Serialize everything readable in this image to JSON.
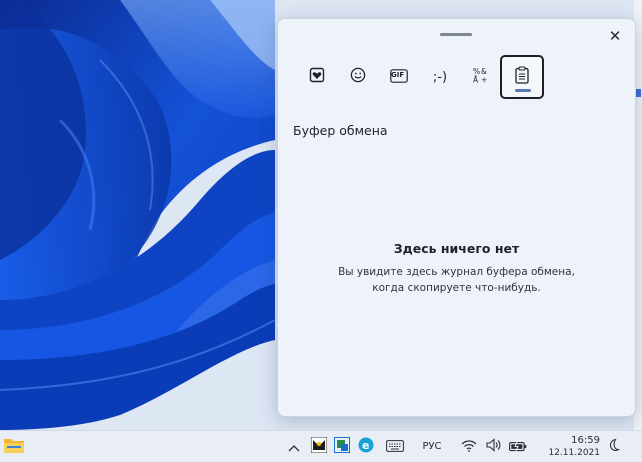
{
  "panel": {
    "close_label": "✕",
    "tabs": [
      {
        "name": "recently-used-tab",
        "icon": "heart-sticker-icon",
        "active": false
      },
      {
        "name": "emoji-tab",
        "icon": "smiley-icon",
        "active": false
      },
      {
        "name": "gif-tab",
        "icon": "gif-icon",
        "label": "GIF",
        "active": false
      },
      {
        "name": "kaomoji-tab",
        "icon": "kaomoji-icon",
        "label": ";-)",
        "active": false
      },
      {
        "name": "symbols-tab",
        "icon": "symbols-icon",
        "active": false
      },
      {
        "name": "clipboard-tab",
        "icon": "clipboard-icon",
        "active": true
      }
    ],
    "section_title": "Буфер обмена",
    "empty_title": "Здесь ничего нет",
    "empty_line1": "Вы увидите здесь журнал буфера обмена,",
    "empty_line2": "когда скопируете что-нибудь."
  },
  "taskbar": {
    "language": "РУС",
    "time": "16:59",
    "date": "12.11.2021",
    "icons": [
      "file-explorer-icon",
      "chevron-up-icon",
      "tray-app-icon-1",
      "tray-app-icon-2",
      "edge-icon",
      "keyboard-icon",
      "wifi-icon",
      "volume-icon",
      "battery-icon",
      "notification-moon-icon"
    ]
  },
  "colors": {
    "accent": "#5a78b8",
    "panel_bg": "#eef2f9",
    "wallpaper_blue": "#1147c8"
  }
}
